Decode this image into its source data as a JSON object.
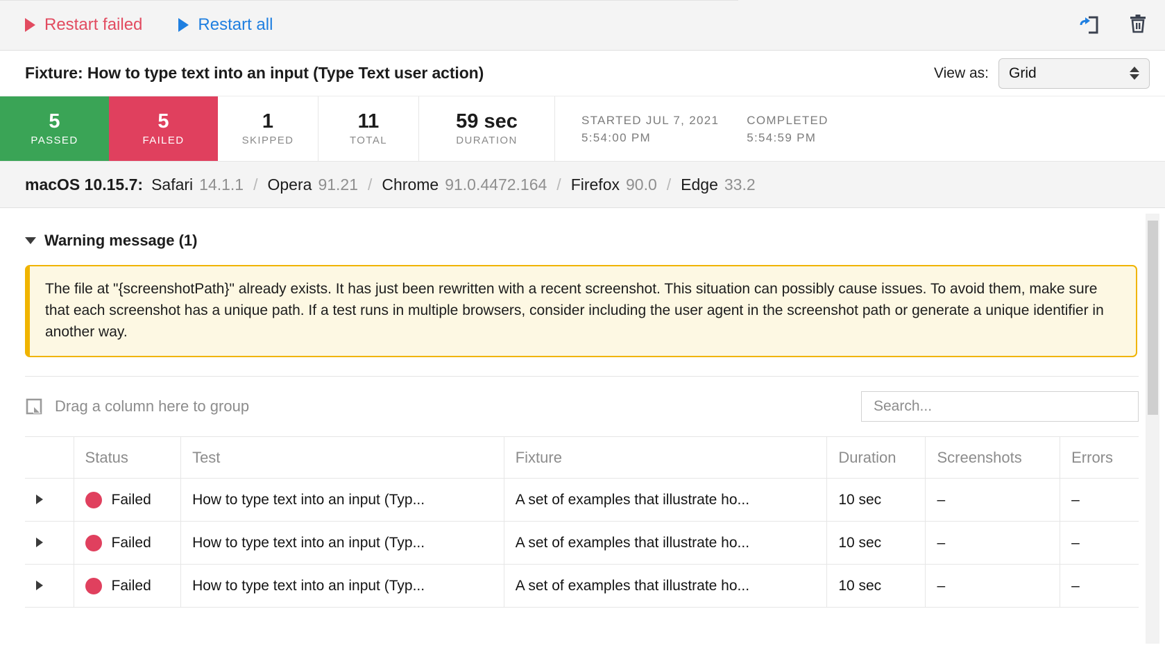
{
  "toolbar": {
    "restart_failed_label": "Restart failed",
    "restart_all_label": "Restart all",
    "export_icon": "export-open-in-icon",
    "delete_icon": "trash-icon",
    "restart_failed_color": "#e24b60",
    "restart_all_color": "#1f7fe0"
  },
  "header": {
    "fixture_title": "Fixture: How to type text into an input (Type Text user action)",
    "view_as_label": "View as:",
    "view_as_value": "Grid",
    "view_as_options": [
      "Grid"
    ]
  },
  "stats": {
    "passed": {
      "value": "5",
      "label": "PASSED",
      "color": "#3aa456"
    },
    "failed": {
      "value": "5",
      "label": "FAILED",
      "color": "#e0405e"
    },
    "skipped": {
      "value": "1",
      "label": "SKIPPED"
    },
    "total": {
      "value": "11",
      "label": "TOTAL"
    },
    "duration": {
      "value": "59 sec",
      "label": "DURATION"
    },
    "started": {
      "label": "STARTED JUL 7, 2021",
      "value": "5:54:00 PM"
    },
    "completed": {
      "label": "COMPLETED",
      "value": "5:54:59 PM"
    }
  },
  "environment": {
    "os": "macOS 10.15.7:",
    "browsers": [
      {
        "name": "Safari",
        "version": "14.1.1"
      },
      {
        "name": "Opera",
        "version": "91.21"
      },
      {
        "name": "Chrome",
        "version": "91.0.4472.164"
      },
      {
        "name": "Firefox",
        "version": "90.0"
      },
      {
        "name": "Edge",
        "version": "33.2"
      }
    ],
    "separator": "/"
  },
  "warning": {
    "section_title": "Warning message (1)",
    "text": "The file at \"{screenshotPath}\" already exists. It has just been rewritten with a recent screenshot. This situation can possibly cause issues. To avoid them, make sure that each screenshot has a unique path. If a test runs in multiple browsers, consider including the user agent in the screenshot path or generate a unique identifier in another way.",
    "border_color": "#f0b400",
    "background_color": "#fdf8e3"
  },
  "grid_toolbar": {
    "group_hint": "Drag a column here to group",
    "search_placeholder": "Search...",
    "search_value": ""
  },
  "grid": {
    "columns": [
      "",
      "Status",
      "Test",
      "Fixture",
      "Duration",
      "Screenshots",
      "Errors"
    ],
    "rows": [
      {
        "status": "Failed",
        "status_color": "#e0405e",
        "test": "How to type text into an input (Typ...",
        "fixture": "A set of examples that illustrate ho...",
        "duration": "10 sec",
        "screenshots": "–",
        "errors": "–"
      },
      {
        "status": "Failed",
        "status_color": "#e0405e",
        "test": "How to type text into an input (Typ...",
        "fixture": "A set of examples that illustrate ho...",
        "duration": "10 sec",
        "screenshots": "–",
        "errors": "–"
      },
      {
        "status": "Failed",
        "status_color": "#e0405e",
        "test": "How to type text into an input (Typ...",
        "fixture": "A set of examples that illustrate ho...",
        "duration": "10 sec",
        "screenshots": "–",
        "errors": "–"
      }
    ]
  }
}
